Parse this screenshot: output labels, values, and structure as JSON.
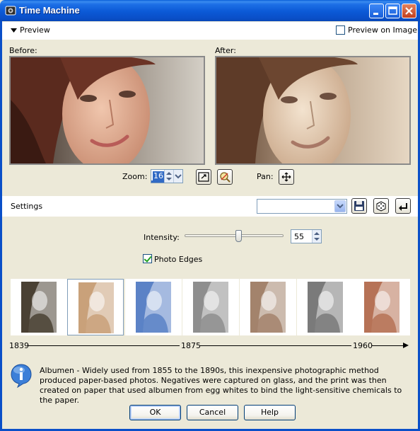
{
  "window": {
    "title": "Time Machine"
  },
  "preview": {
    "section_label": "Preview",
    "preview_on_image_label": "Preview on Image",
    "preview_on_image_checked": false,
    "before_label": "Before:",
    "after_label": "After:",
    "zoom_label": "Zoom:",
    "zoom_value": "16",
    "pan_label": "Pan:"
  },
  "settings": {
    "label": "Settings",
    "preset_value": ""
  },
  "intensity": {
    "label": "Intensity:",
    "value": "55",
    "level_percent": 55
  },
  "photo_edges": {
    "label": "Photo Edges",
    "checked": true
  },
  "styles": {
    "selected_index": 1,
    "items": [
      {
        "name": "style-1839",
        "tint": "#4a4134"
      },
      {
        "name": "style-albumen",
        "tint": "#c9a17a"
      },
      {
        "name": "style-cyanotype",
        "tint": "#5b82c6"
      },
      {
        "name": "style-platinum",
        "tint": "#8e8e8e"
      },
      {
        "name": "style-sepia",
        "tint": "#a3836c"
      },
      {
        "name": "style-bw",
        "tint": "#7a7a7a"
      },
      {
        "name": "style-color",
        "tint": "#b67256"
      }
    ]
  },
  "timeline": {
    "start": "1839",
    "middle": "1875",
    "end": "1960"
  },
  "description": "Albumen - Widely used from 1855 to the 1890s, this inexpensive photographic method produced paper-based photos. Negatives were captured on glass, and the print was then created on paper that used albumen from egg whites to bind the light-sensitive chemicals to the paper.",
  "buttons": {
    "ok": "OK",
    "cancel": "Cancel",
    "help": "Help"
  },
  "colors": {
    "titlebar": "#0a59d6",
    "selection": "#316ac5",
    "checkmark": "#21a121"
  }
}
